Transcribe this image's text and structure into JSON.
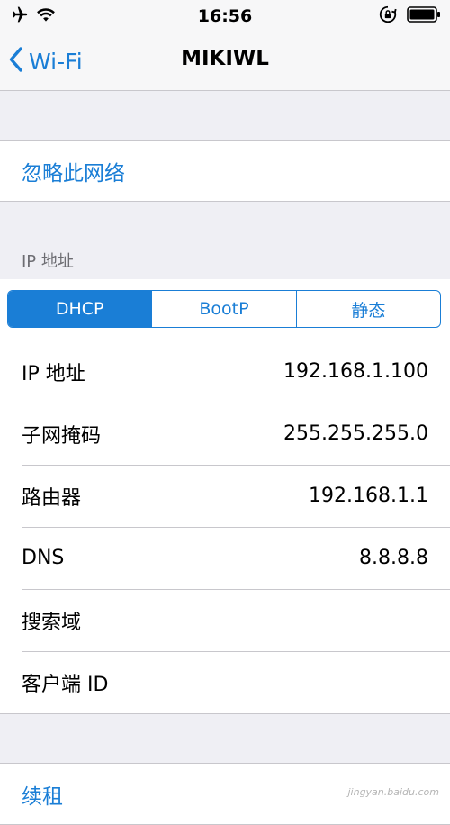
{
  "status_bar": {
    "time": "16:56",
    "left_icons": [
      "airplane-icon",
      "wifi-icon"
    ],
    "right_icons": [
      "rotation-lock-icon",
      "battery-icon"
    ]
  },
  "nav": {
    "back_label": "Wi-Fi",
    "title": "MIKIWL"
  },
  "forget_network": {
    "label": "忽略此网络"
  },
  "ip_section": {
    "header": "IP 地址",
    "segments": [
      {
        "label": "DHCP",
        "selected": true
      },
      {
        "label": "BootP",
        "selected": false
      },
      {
        "label": "静态",
        "selected": false
      }
    ],
    "rows": [
      {
        "label": "IP 地址",
        "value": "192.168.1.100"
      },
      {
        "label": "子网掩码",
        "value": "255.255.255.0"
      },
      {
        "label": "路由器",
        "value": "192.168.1.1"
      },
      {
        "label": "DNS",
        "value": "8.8.8.8"
      },
      {
        "label": "搜索域",
        "value": ""
      },
      {
        "label": "客户端 ID",
        "value": ""
      }
    ]
  },
  "renew": {
    "label": "续租"
  },
  "colors": {
    "accent": "#1a7ed6",
    "background": "#efeff4",
    "separator": "#c8c7cc"
  },
  "watermark": "jingyan.baidu.com"
}
